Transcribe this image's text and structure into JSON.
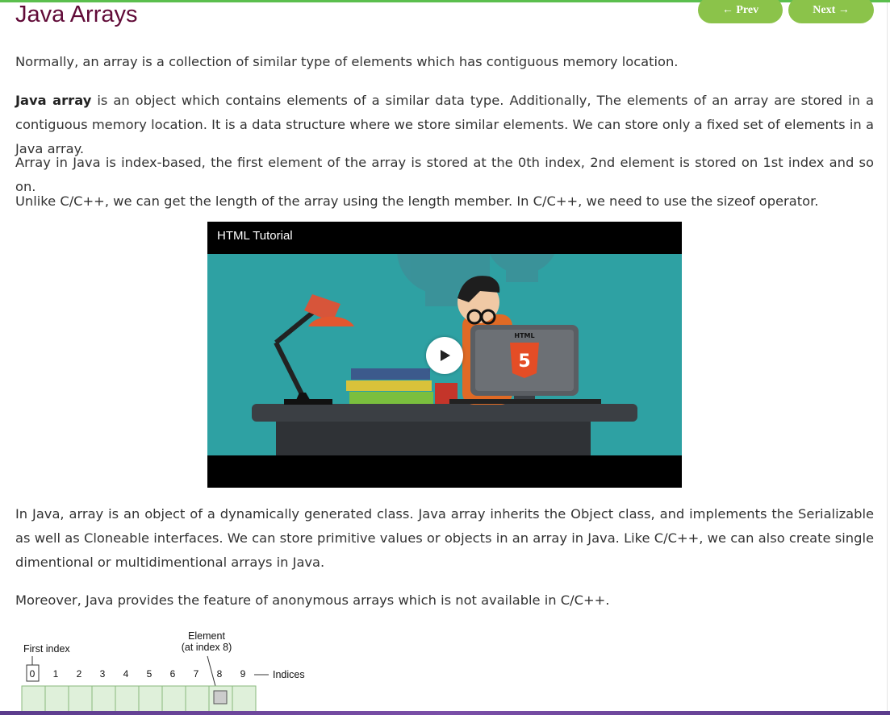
{
  "page": {
    "title": "Java Arrays"
  },
  "nav": {
    "prev_label": "← Prev",
    "next_label": "Next →"
  },
  "content": {
    "p1": "Normally, an array is a collection of similar type of elements which has contiguous memory location.",
    "p2_bold": "Java array",
    "p2_rest": " is an object which contains elements of a similar data type. Additionally, The elements of an array are stored in a contiguous memory location. It is a data structure where we store similar elements. We can store only a fixed set of elements in a Java array.",
    "p3": "Array in Java is index-based, the first element of the array is stored at the 0th index, 2nd element is stored on 1st index and so on.",
    "p4": "Unlike C/C++, we can get the length of the array using the length member. In C/C++, we need to use the sizeof operator.",
    "p5": "In Java, array is an object of a dynamically generated class. Java array inherits the Object class, and implements the Serializable as well as Cloneable interfaces. We can store primitive values or objects in an array in Java. Like C/C++, we can also create single dimentional or multidimentional arrays in Java.",
    "p6": "Moreover, Java provides the feature of anonymous arrays which is not available in C/C++."
  },
  "video": {
    "title": "HTML Tutorial",
    "screen_label": "HTML",
    "badge_number": "5",
    "icon": "play-icon"
  },
  "diagram": {
    "first_index_label": "First index",
    "element_label_line1": "Element",
    "element_label_line2": "(at index 8)",
    "indices_label": "Indices",
    "indices": [
      "0",
      "1",
      "2",
      "3",
      "4",
      "5",
      "6",
      "7",
      "8",
      "9"
    ]
  },
  "colors": {
    "title": "#610b38",
    "nav_button": "#8bc34a",
    "top_accent": "#5bbf4e"
  }
}
